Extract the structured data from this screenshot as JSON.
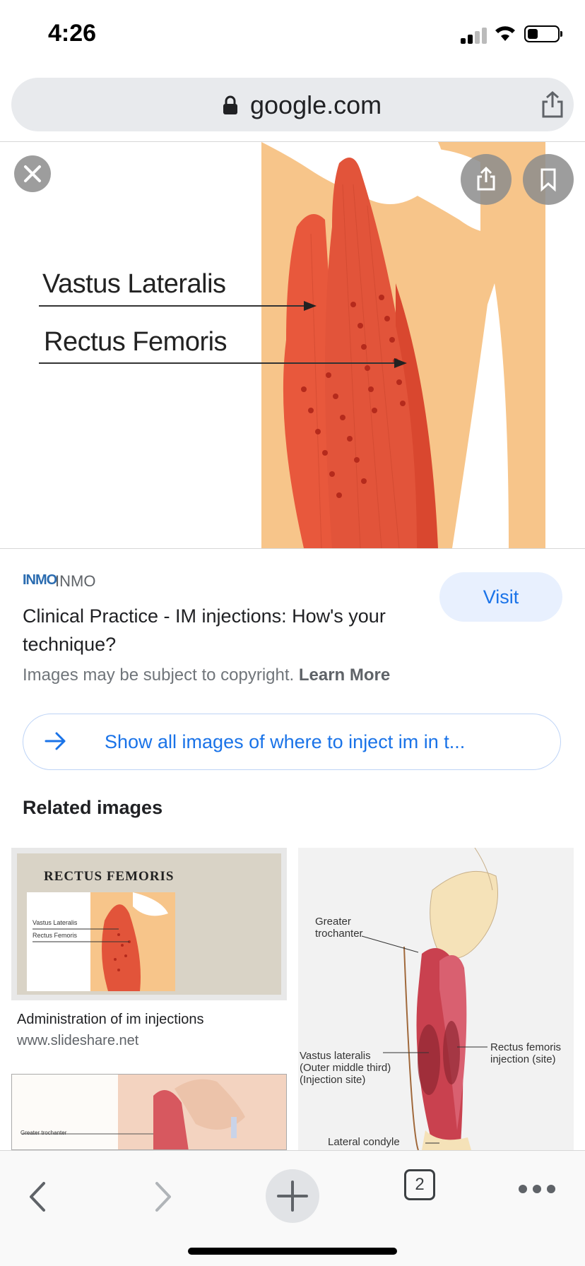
{
  "status_bar": {
    "time": "4:26"
  },
  "url_bar": {
    "host": "google.com"
  },
  "hero": {
    "label_1": "Vastus Lateralis",
    "label_2": "Rectus Femoris"
  },
  "source": {
    "logo": "INMO",
    "name": "INMO",
    "title": "Clinical Practice - IM injections: How's your technique?",
    "visit_label": "Visit",
    "copyright_text": "Images may be subject to copyright.",
    "learn_more": "Learn More"
  },
  "show_all_label": "Show all images of where to inject im in t...",
  "related": {
    "heading": "Related images",
    "items": [
      {
        "image_heading": "RECTUS  FEMORIS",
        "image_label_1": "Vastus Lateralis",
        "image_label_2": "Rectus Femoris",
        "title": "Administration of im injections",
        "site": "www.slideshare.net"
      },
      {
        "image_label_1": "Greater trochanter"
      },
      {
        "label_greater": "Greater\ntrochanter",
        "label_vastus": "Vastus lateralis\n(Outer middle third)\n(Injection site)",
        "label_rectus": "Rectus femoris\ninjection (site)",
        "label_condyle": "Lateral condyle"
      }
    ]
  },
  "toolbar": {
    "tab_count": "2"
  },
  "colors": {
    "accent": "#1a73e8",
    "visit_bg": "#e8f0fe",
    "muscle": "#e2543a",
    "bone": "#f7c58a"
  },
  "icons": [
    "lock-icon",
    "share-icon",
    "close-icon",
    "bookmark-icon",
    "arrow-right-icon",
    "back-icon",
    "forward-icon",
    "plus-icon",
    "tabs-icon",
    "more-icon"
  ]
}
